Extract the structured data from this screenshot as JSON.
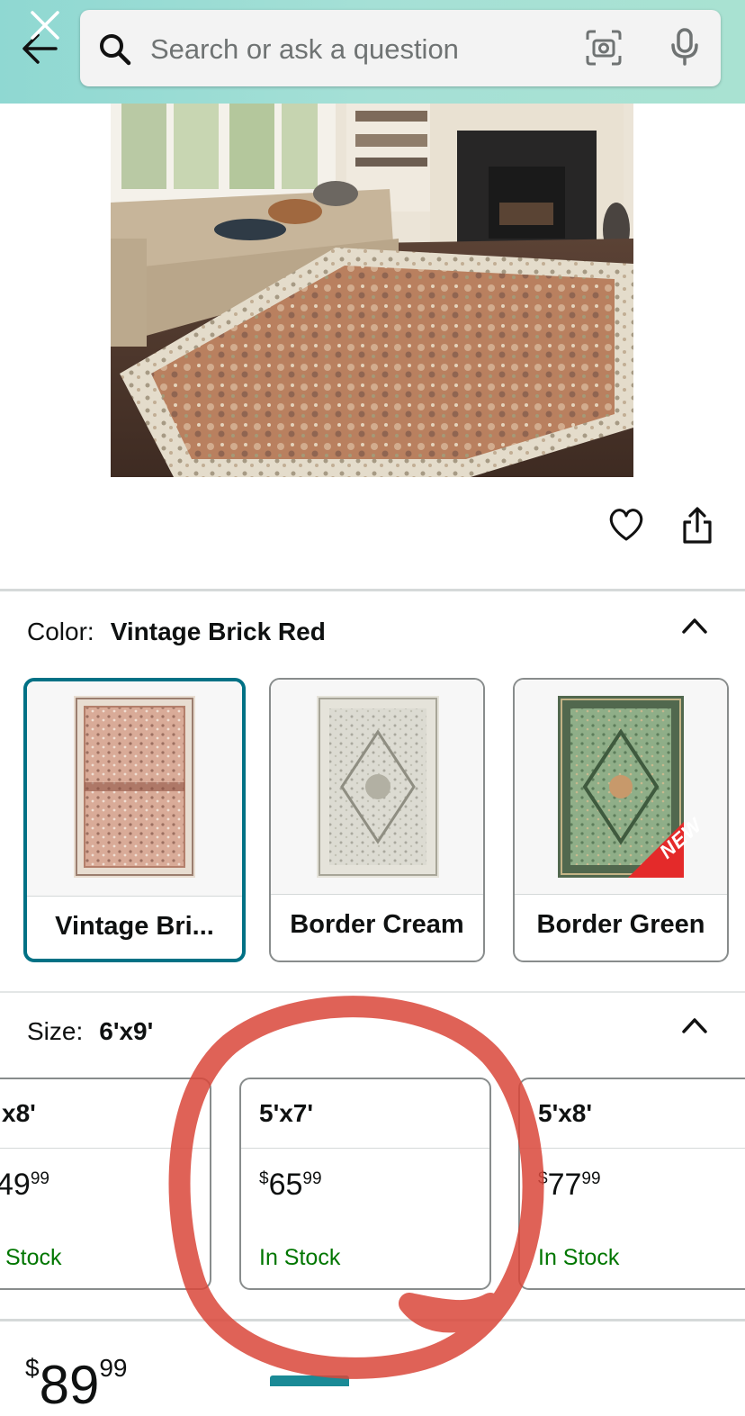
{
  "search": {
    "placeholder": "Search or ask a question"
  },
  "color_selector": {
    "label": "Color:",
    "selected_value": "Vintage Brick Red",
    "options": [
      {
        "label": "Vintage Bri...",
        "selected": true
      },
      {
        "label": "Border Cream",
        "selected": false
      },
      {
        "label": "Border Green",
        "selected": false,
        "badge": "NEW"
      }
    ]
  },
  "size_selector": {
    "label": "Size:",
    "selected_value": "6'x9'",
    "options": [
      {
        "name": "x8'",
        "price_main": "49",
        "price_cents": "99",
        "stock": "Stock"
      },
      {
        "name": "5'x7'",
        "price_symbol": "$",
        "price_main": "65",
        "price_cents": "99",
        "stock": "In Stock"
      },
      {
        "name": "5'x8'",
        "price_symbol": "$",
        "price_main": "77",
        "price_cents": "99",
        "stock": "In Stock"
      }
    ]
  },
  "bottom_price": {
    "symbol": "$",
    "main": "89",
    "cents": "99"
  },
  "colors": {
    "header_gradient_start": "#8fd8d2",
    "header_gradient_end": "#a9e2d2",
    "selected_border": "#007185",
    "in_stock_green": "#007600",
    "annotation_red": "#d9463a"
  },
  "icons": [
    "close-icon",
    "back-arrow-icon",
    "search-icon",
    "camera-icon",
    "microphone-icon",
    "heart-icon",
    "share-icon",
    "chevron-up-icon"
  ]
}
